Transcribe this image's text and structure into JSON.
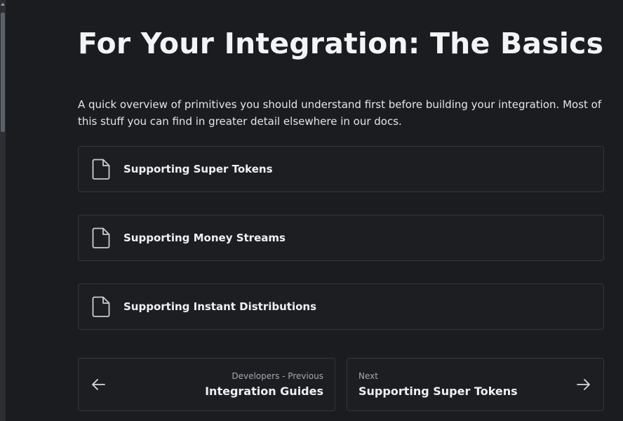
{
  "page": {
    "title": "For Your Integration: The Basics",
    "description": "A quick overview of primitives you should understand first before building your integration. Most of this stuff you can find in greater detail elsewhere in our docs."
  },
  "cards": [
    {
      "label": "Supporting Super Tokens",
      "icon": "document-icon"
    },
    {
      "label": "Supporting Money Streams",
      "icon": "document-icon"
    },
    {
      "label": "Supporting Instant Distributions",
      "icon": "document-icon"
    }
  ],
  "pagination": {
    "previous": {
      "caption": "Developers - Previous",
      "title": "Integration Guides",
      "icon": "arrow-left-icon"
    },
    "next": {
      "caption": "Next",
      "title": "Supporting Super Tokens",
      "icon": "arrow-right-icon"
    }
  },
  "icons": {
    "more": "more-vertical-icon"
  },
  "colors": {
    "background": "#1a1c1f",
    "card_border": "#33363b",
    "text_primary": "#eef0f3",
    "text_secondary": "#a4a9b0"
  }
}
